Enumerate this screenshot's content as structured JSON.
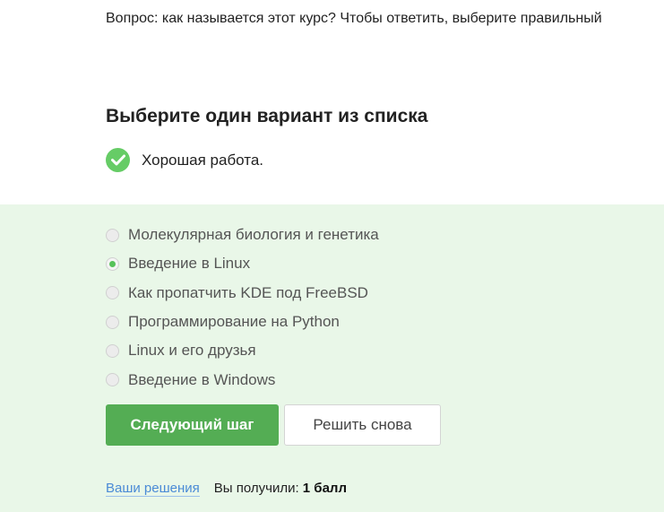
{
  "question": "Вопрос: как называется этот курс? Чтобы ответить, выберите правильный",
  "heading": "Выберите один вариант из списка",
  "feedback": {
    "icon": "check-circle-icon",
    "text": "Хорошая работа.",
    "color": "#66cc66"
  },
  "options": [
    {
      "label": "Молекулярная биология и генетика",
      "selected": false
    },
    {
      "label": "Введение в Linux",
      "selected": true
    },
    {
      "label": "Как пропатчить KDE под FreeBSD",
      "selected": false
    },
    {
      "label": "Программирование на Python",
      "selected": false
    },
    {
      "label": "Linux и его друзья",
      "selected": false
    },
    {
      "label": "Введение в Windows",
      "selected": false
    }
  ],
  "buttons": {
    "next": "Следующий шаг",
    "retry": "Решить снова"
  },
  "footer": {
    "solutions_link": "Ваши решения",
    "score_label": "Вы получили:",
    "score_value": "1 балл"
  },
  "colors": {
    "accent": "#54ad54",
    "band": "#e9f7e8",
    "link": "#4b8bd6"
  }
}
